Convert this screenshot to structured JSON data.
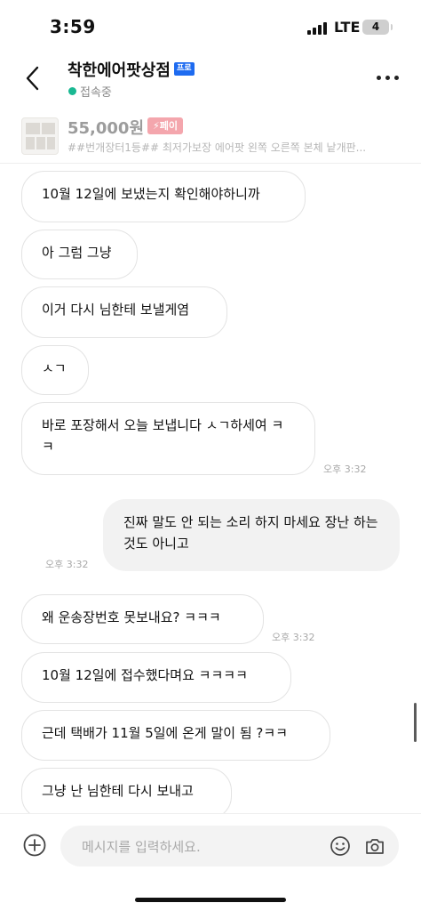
{
  "status_bar": {
    "time": "3:59",
    "network": "LTE",
    "battery": "4"
  },
  "header": {
    "shop_name": "착한에어팟상점",
    "badge": "프로",
    "status": "접속중",
    "back_icon": "chevron-left-icon",
    "more_icon": "more-horizontal-icon"
  },
  "product": {
    "price": "55,000원",
    "pay_badge": "⚡페이",
    "description": "##번개장터1등## 최저가보장 에어팟 왼쪽 오른쪽 본체 낱개판..."
  },
  "messages": [
    {
      "direction": "in",
      "text": "10월 12일에 보냈는지 확인해야하니까"
    },
    {
      "direction": "in",
      "text": "아 그럼 그냥"
    },
    {
      "direction": "in",
      "text": "이거 다시 님한테 보낼게염"
    },
    {
      "direction": "in",
      "text": "ㅅㄱ"
    },
    {
      "direction": "in",
      "text": "바로 포장해서 오늘 보냅니다 ㅅㄱ하세여 ㅋㅋ",
      "time": "오후 3:32"
    },
    {
      "direction": "out",
      "text": "진짜 말도 안 되는 소리 하지 마세요 장난 하는 것도 아니고",
      "time": "오후 3:32"
    },
    {
      "direction": "in",
      "text": "왜 운송장번호 못보내요? ㅋㅋㅋ",
      "time": "오후 3:32"
    },
    {
      "direction": "in",
      "text": "10월 12일에 접수했다며요 ㅋㅋㅋㅋ"
    },
    {
      "direction": "in",
      "text": "근데 택배가 11월 5일에 온게 말이 됨 ?ㅋㅋ"
    },
    {
      "direction": "in",
      "text": "그냥 난 님한테 다시 보내고"
    }
  ],
  "input": {
    "placeholder": "메시지를 입력하세요.",
    "add_icon": "plus-circle-icon",
    "emoji_icon": "smile-icon",
    "camera_icon": "camera-icon"
  },
  "colors": {
    "online": "#19b892",
    "pro_badge": "#1e6bf0",
    "pay_badge": "#f4a6ad"
  }
}
